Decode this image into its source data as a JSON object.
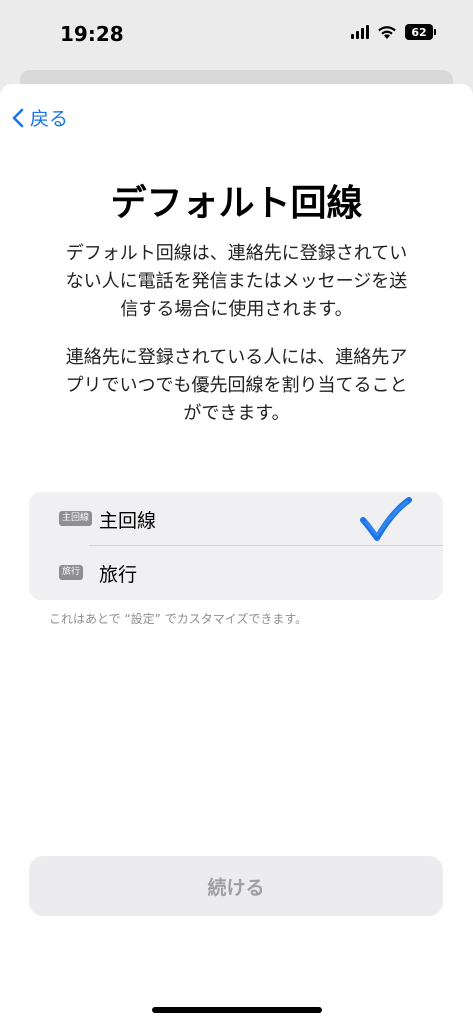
{
  "status_bar": {
    "time": "19:28",
    "battery": "62",
    "icons": [
      "signal-icon",
      "wifi-icon",
      "battery-icon"
    ]
  },
  "nav": {
    "back_label": "戻る"
  },
  "page": {
    "title": "デフォルト回線",
    "description_1": "デフォルト回線は、連絡先に登録されていない人に電話を発信またはメッセージを送信する場合に使用されます。",
    "description_2": "連絡先に登録されている人には、連絡先アプリでいつでも優先回線を割り当てることができます。"
  },
  "lines": [
    {
      "badge": "主回線",
      "name": "主回線",
      "selected": true
    },
    {
      "badge": "旅行",
      "name": "旅行",
      "selected": false
    }
  ],
  "footnote": "これはあとで “設定” でカスタマイズできます。",
  "continue_label": "続ける",
  "colors": {
    "accent": "#1a73e8",
    "badge": "#8e8e93",
    "disabled_text": "#9e9ea3",
    "list_bg": "#f0f0f2"
  }
}
